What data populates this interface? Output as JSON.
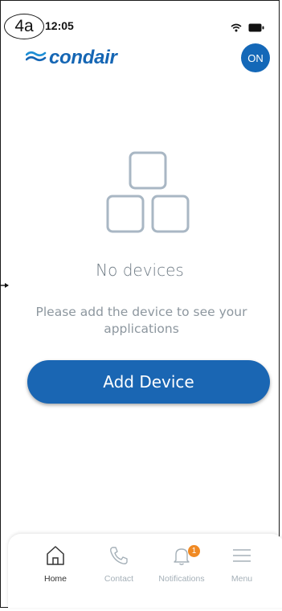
{
  "annotation": {
    "callout_label": "4a"
  },
  "status_bar": {
    "time": "12:05",
    "icons": [
      "wifi-icon",
      "battery-icon"
    ]
  },
  "header": {
    "brand": "condair",
    "power_badge": "ON"
  },
  "empty_state": {
    "title": "No devices",
    "message": "Please add the device to see your applications",
    "action_label": "Add Device"
  },
  "tab_bar": {
    "items": [
      {
        "label": "Home",
        "icon": "home-icon",
        "active": true
      },
      {
        "label": "Contact",
        "icon": "phone-icon",
        "active": false
      },
      {
        "label": "Notifications",
        "icon": "bell-icon",
        "active": false,
        "badge": "1"
      },
      {
        "label": "Menu",
        "icon": "menu-icon",
        "active": false
      }
    ]
  },
  "colors": {
    "brand_blue": "#1566b4",
    "button_blue": "#1a66b3",
    "muted_text": "#8d979f",
    "icon_gray": "#a5b0b8",
    "badge_orange": "#f08a24"
  }
}
